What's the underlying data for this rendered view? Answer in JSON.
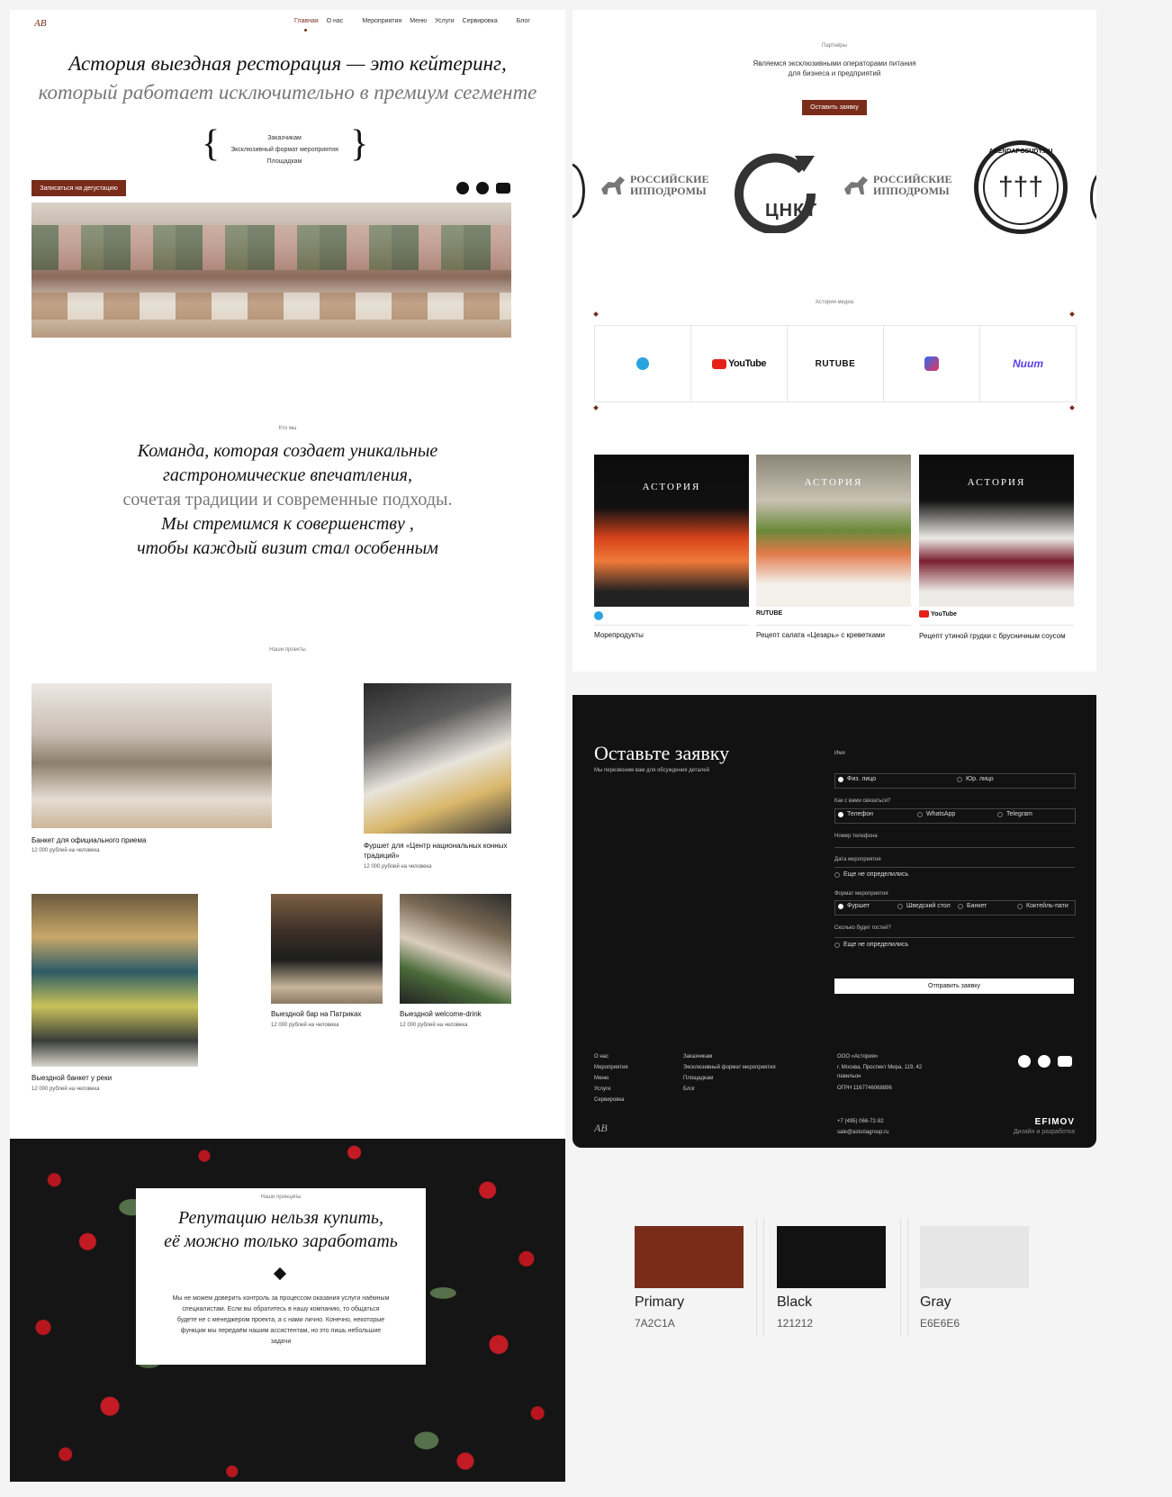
{
  "colors": {
    "primary": "#7A2C1A",
    "black": "#121212",
    "gray": "#E6E6E6"
  },
  "left": {
    "logo": "AB",
    "nav": [
      "Главная",
      "О нас",
      "Мероприятия",
      "Меню",
      "Услуги",
      "Сервировка",
      "Блог"
    ],
    "hero_line1": "Астория выездная ресторация — это кейтеринг,",
    "hero_line2": "который работает исключительно в премиум сегменте",
    "brace_items": [
      "Заказчикам",
      "Эксклюзивный формат мероприятия",
      "Площадкам"
    ],
    "tasting_button": "Записаться на дегустацию",
    "social_icons": [
      "telegram-icon",
      "whatsapp-icon",
      "youtube-icon"
    ],
    "who_label": "Кто мы",
    "who_lines": [
      "Команда, которая создает уникальные",
      "гастрономические впечатления,",
      "сочетая традиции и современные подходы.",
      "Мы стремимся к совершенству ,",
      "чтобы каждый визит стал особенным"
    ],
    "projects_label": "Наши проекты",
    "projects": [
      {
        "title": "Банкет для официального приема",
        "price": "12 000 рублей на человека"
      },
      {
        "title": "Фуршет для «Центр национальных конных традиций»",
        "price": "12 000 рублей на человека"
      },
      {
        "title": "Выездной банкет у реки",
        "price": "12 000 рублей на человека"
      },
      {
        "title": "Выездной бар на Патриках",
        "price": "12 000 рублей на человека"
      },
      {
        "title": "Выездной welcome-drink",
        "price": "12 000 рублей на человека"
      }
    ],
    "principles_label": "Наши принципы",
    "principles_title1": "Репутацию нельзя купить,",
    "principles_title2": "её можно только заработать",
    "principles_text": "Мы не можем доверить контроль за процессом оказания услуги наёмным специалистам. Если вы обратитесь в нашу компанию, то общаться будете не с менеджером проекта, а с нами лично. Конечно, некоторые функции мы передаём нашим ассистентам, но это лишь небольшие задачи"
  },
  "partners": {
    "label": "Партнёры",
    "text1": "Являемся эксклюзивными операторами питания",
    "text2": "для бизнеса и предприятий",
    "button": "Оставить заявку",
    "logos": [
      "РОССИЙСКИЕ",
      "ИППОДРОМЫ",
      "ЦНКТ",
      "ARENDAPOSUDY.RU"
    ]
  },
  "media": {
    "label": "Астория медиа",
    "items": [
      "telegram-icon",
      "YouTube",
      "RUTUBE",
      "vk-video-icon",
      "Nuum"
    ],
    "posts": [
      {
        "platform": "",
        "title": "Морепродукты"
      },
      {
        "platform": "RUTUBE",
        "title": "Рецепт салата «Цезарь» с креветками"
      },
      {
        "platform": "YouTube",
        "title": "Рецепт утиной грудки с брусничным соусом"
      }
    ],
    "brand": "АСТОРИЯ"
  },
  "form": {
    "title": "Оставьте заявку",
    "subtitle": "Мы перезвоним вам для обсуждения деталей",
    "name_label": "Имя",
    "person_options": [
      "Физ. лицо",
      "Юр. лицо"
    ],
    "contact_label": "Как с вами связаться?",
    "contact_options": [
      "Телефон",
      "WhatsApp",
      "Telegram"
    ],
    "phone_label": "Номер телефона",
    "date_label": "Дата мероприятия",
    "undecided": "Еще не определились",
    "format_label": "Формат мероприятия",
    "format_options": [
      "Фуршет",
      "Шведский стол",
      "Банкет",
      "Коктейль-пати"
    ],
    "guests_label": "Сколько будет гостей?",
    "submit": "Отправить заявку"
  },
  "footer": {
    "col1": [
      "О нас",
      "Мероприятия",
      "Меню",
      "Услуги",
      "Сервировка"
    ],
    "col2": [
      "Заказчикам",
      "Эксклюзивный формат мероприятия",
      "Площадкам",
      "Блог"
    ],
    "company": "ООО «Астория»",
    "address1": "г. Москва, Проспект Мира, 119, 42",
    "address2": "павильон",
    "ogrn": "ОГРН 1167746068896",
    "phone": "+7 (495) 066-72-92",
    "email": "sale@astoriagroup.ru",
    "dev": "EFIMOV",
    "dev_sub": "Дизайн и разработка"
  },
  "palette": [
    {
      "name": "Primary",
      "hex": "7A2C1A"
    },
    {
      "name": "Black",
      "hex": "121212"
    },
    {
      "name": "Gray",
      "hex": "E6E6E6"
    }
  ]
}
